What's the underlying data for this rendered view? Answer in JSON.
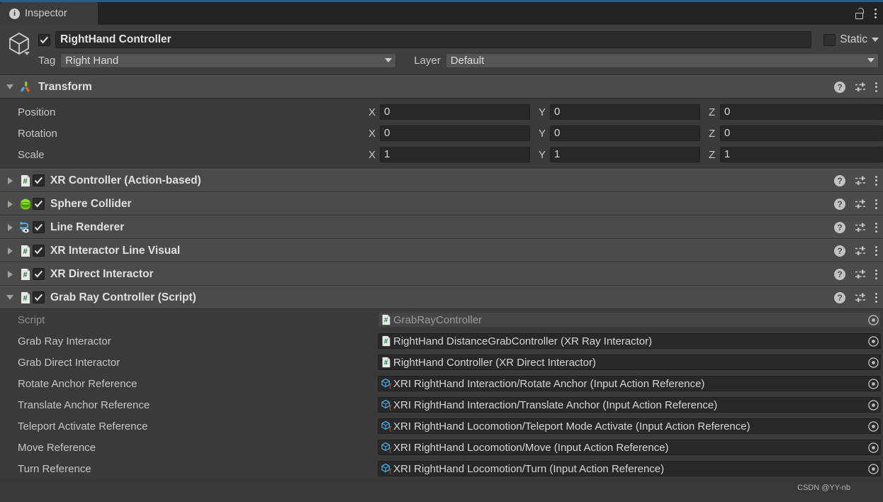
{
  "window": {
    "tab_label": "Inspector",
    "tab_icon": "info-icon",
    "lock_icon": "lock-icon",
    "menu_icon": "kebab-menu-icon",
    "accent_color": "#2c5d87"
  },
  "object_header": {
    "icon": "cube-icon",
    "enabled": true,
    "name": "RightHand Controller",
    "static_label": "Static",
    "static_checked": false,
    "tag_label": "Tag",
    "tag_value": "Right Hand",
    "layer_label": "Layer",
    "layer_value": "Default"
  },
  "transform": {
    "title": "Transform",
    "icon": "transform-axis-icon",
    "expanded": true,
    "help_icon": "help-icon",
    "preset_icon": "preset-icon",
    "menu_icon": "kebab-menu-icon",
    "rows": [
      {
        "label": "Position",
        "x": "0",
        "y": "0",
        "z": "0"
      },
      {
        "label": "Rotation",
        "x": "0",
        "y": "0",
        "z": "0"
      },
      {
        "label": "Scale",
        "x": "1",
        "y": "1",
        "z": "1"
      }
    ],
    "axis_labels": {
      "x": "X",
      "y": "Y",
      "z": "Z"
    }
  },
  "components": [
    {
      "title": "XR Controller (Action-based)",
      "icon": "cs-script-icon",
      "expanded": false,
      "enabled": true
    },
    {
      "title": "Sphere Collider",
      "icon": "sphere-collider-icon",
      "expanded": false,
      "enabled": true
    },
    {
      "title": "Line Renderer",
      "icon": "line-renderer-icon",
      "expanded": false,
      "enabled": true
    },
    {
      "title": "XR Interactor Line Visual",
      "icon": "cs-script-icon",
      "expanded": false,
      "enabled": true
    },
    {
      "title": "XR Direct Interactor",
      "icon": "cs-script-icon",
      "expanded": false,
      "enabled": true
    },
    {
      "title": "Grab Ray Controller (Script)",
      "icon": "cs-script-icon",
      "expanded": true,
      "enabled": true
    }
  ],
  "grab_ray_controller": {
    "properties": [
      {
        "label": "Script",
        "value": "GrabRayController",
        "icon": "cs-script-icon",
        "readonly": true
      },
      {
        "label": "Grab Ray Interactor",
        "value": "RightHand DistanceGrabController (XR Ray Interactor)",
        "icon": "cs-script-icon",
        "readonly": false
      },
      {
        "label": "Grab Direct Interactor",
        "value": "RightHand Controller (XR Direct Interactor)",
        "icon": "cs-script-icon",
        "readonly": false
      },
      {
        "label": "Rotate Anchor Reference",
        "value": "XRI RightHand Interaction/Rotate Anchor (Input Action Reference)",
        "icon": "input-action-icon",
        "readonly": false
      },
      {
        "label": "Translate Anchor Reference",
        "value": "XRI RightHand Interaction/Translate Anchor (Input Action Reference)",
        "icon": "input-action-icon",
        "readonly": false
      },
      {
        "label": "Teleport Activate Reference",
        "value": "XRI RightHand Locomotion/Teleport Mode Activate (Input Action Reference)",
        "icon": "input-action-icon",
        "readonly": false
      },
      {
        "label": "Move Reference",
        "value": "XRI RightHand Locomotion/Move (Input Action Reference)",
        "icon": "input-action-icon",
        "readonly": false
      },
      {
        "label": "Turn Reference",
        "value": "XRI RightHand Locomotion/Turn (Input Action Reference)",
        "icon": "input-action-icon",
        "readonly": false
      }
    ],
    "select_icon": "object-picker-icon"
  },
  "watermark": "CSDN @YY-nb"
}
